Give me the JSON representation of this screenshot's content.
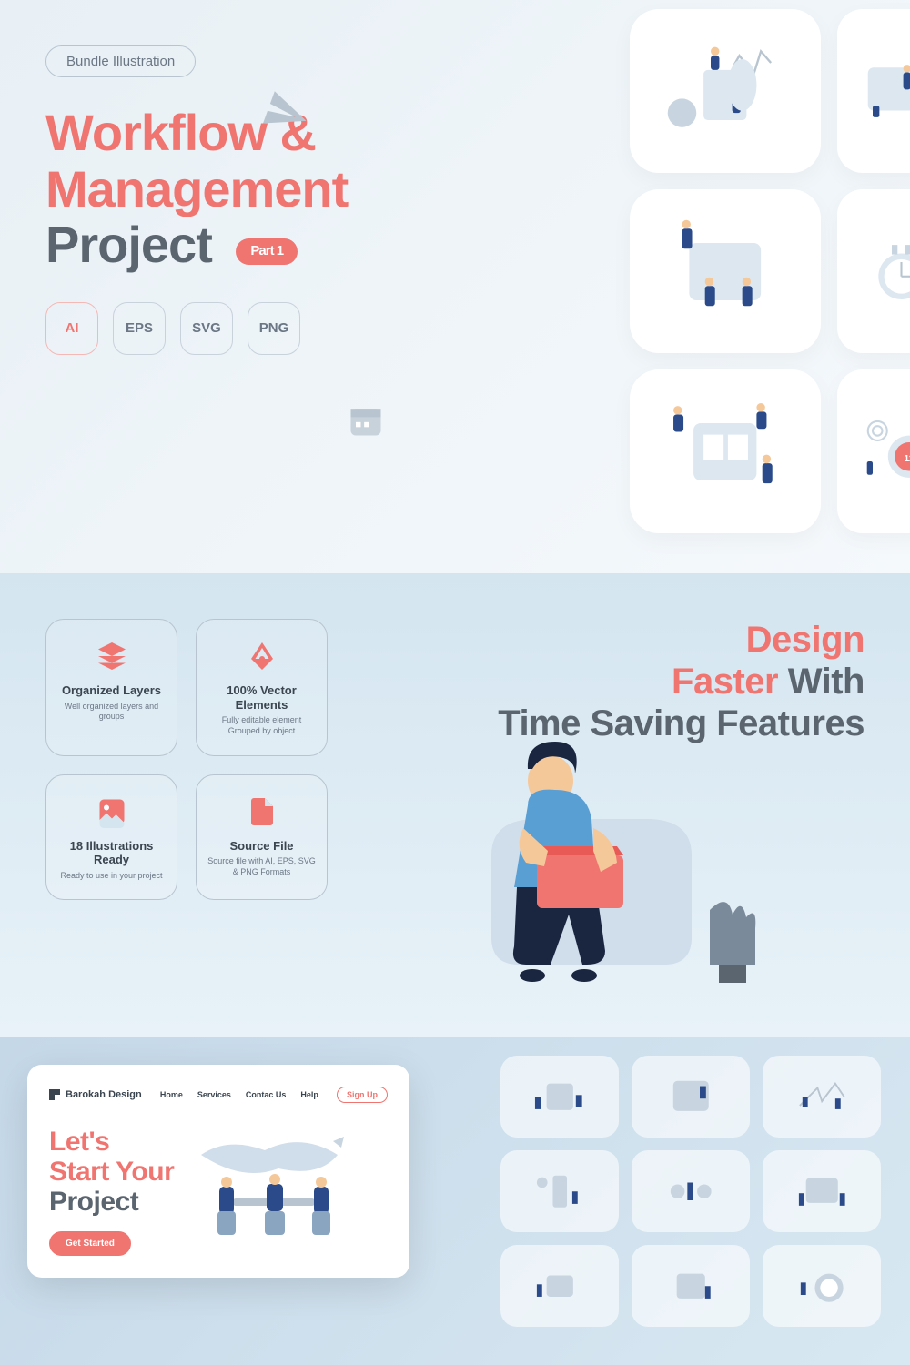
{
  "hero": {
    "badge": "Bundle Illustration",
    "title_line1": "Workflow &",
    "title_line2": "Management",
    "title_line3": "Project",
    "part_label": "Part 1",
    "formats": [
      "AI",
      "EPS",
      "SVG",
      "PNG"
    ]
  },
  "features": {
    "heading_coral1": "Design",
    "heading_coral2": "Faster",
    "heading_grey1": " With",
    "heading_grey2": "Time Saving Features",
    "cards": [
      {
        "title": "Organized Layers",
        "desc": "Well organized layers and groups"
      },
      {
        "title": "100% Vector Elements",
        "desc": "Fully editable element Grouped by object"
      },
      {
        "title": "18 Illustrations Ready",
        "desc": "Ready to use in your project"
      },
      {
        "title": "Source File",
        "desc": "Source file with AI, EPS, SVG & PNG Formats"
      }
    ]
  },
  "mockup": {
    "brand": "Barokah Design",
    "nav": [
      "Home",
      "Services",
      "Contac Us",
      "Help"
    ],
    "signup": "Sign Up",
    "h1": "Let's",
    "h2": "Start Your",
    "h3": "Project",
    "cta": "Get Started"
  }
}
